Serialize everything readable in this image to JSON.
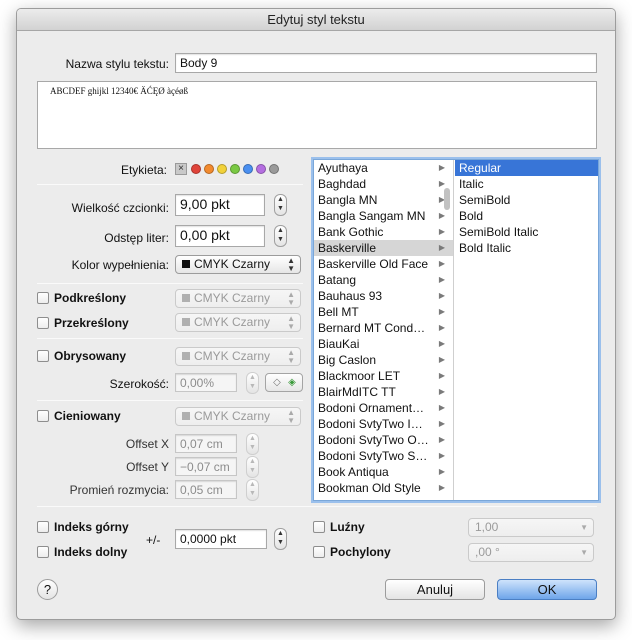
{
  "dialog": {
    "title": "Edytuj styl tekstu"
  },
  "style_name": {
    "label": "Nazwa stylu tekstu:",
    "value": "Body 9"
  },
  "preview": {
    "text": "ABCDEF ghijkl 12340€ ÄĆĘØ àçéøß"
  },
  "tag": {
    "label": "Etykieta:",
    "none_icon": "×",
    "colors": [
      "#e0443a",
      "#f28a2e",
      "#f2d23a",
      "#7ac943",
      "#4a8ff0",
      "#b46ee0",
      "#9a9a9a"
    ]
  },
  "font_size": {
    "label": "Wielkość czcionki:",
    "value": "9,00 pkt"
  },
  "tracking": {
    "label": "Odstęp liter:",
    "value": "0,00 pkt"
  },
  "fill_color": {
    "label": "Kolor wypełnienia:",
    "value": "CMYK Czarny"
  },
  "underline": {
    "label": "Podkreślony",
    "color": "CMYK Czarny"
  },
  "strikethrough": {
    "label": "Przekreślony",
    "color": "CMYK Czarny"
  },
  "outline": {
    "label": "Obrysowany",
    "color": "CMYK Czarny",
    "width_label": "Szerokość:",
    "width_value": "0,00%"
  },
  "shadow": {
    "label": "Cieniowany",
    "color": "CMYK Czarny",
    "offset_x_label": "Offset X",
    "offset_x_value": "0,07 cm",
    "offset_y_label": "Offset Y",
    "offset_y_value": "−0,07 cm",
    "blur_label": "Promień rozmycia:",
    "blur_value": "0,05 cm"
  },
  "fonts": {
    "families": [
      "Ayuthaya",
      "Baghdad",
      "Bangla MN",
      "Bangla Sangam MN",
      "Bank Gothic",
      "Baskerville",
      "Baskerville Old Face",
      "Batang",
      "Bauhaus 93",
      "Bell MT",
      "Bernard MT Cond…",
      "BiauKai",
      "Big Caslon",
      "Blackmoor LET",
      "BlairMdITC TT",
      "Bodoni Ornament…",
      "Bodoni SvtyTwo I…",
      "Bodoni SvtyTwo O…",
      "Bodoni SvtyTwo S…",
      "Book Antiqua",
      "Bookman Old Style"
    ],
    "selected_family": "Baskerville",
    "styles": [
      "Regular",
      "Italic",
      "SemiBold",
      "Bold",
      "SemiBold Italic",
      "Bold Italic"
    ],
    "selected_style": "Regular"
  },
  "superscript": {
    "label": "Indeks górny"
  },
  "subscript": {
    "label": "Indeks dolny"
  },
  "baseline": {
    "label": "+/-",
    "value": "0,0000 pkt"
  },
  "loose": {
    "label": "Luźny",
    "value": "1,00"
  },
  "italic": {
    "label": "Pochylony",
    "value": ",00 °"
  },
  "buttons": {
    "help": "?",
    "cancel": "Anuluj",
    "ok": "OK"
  }
}
